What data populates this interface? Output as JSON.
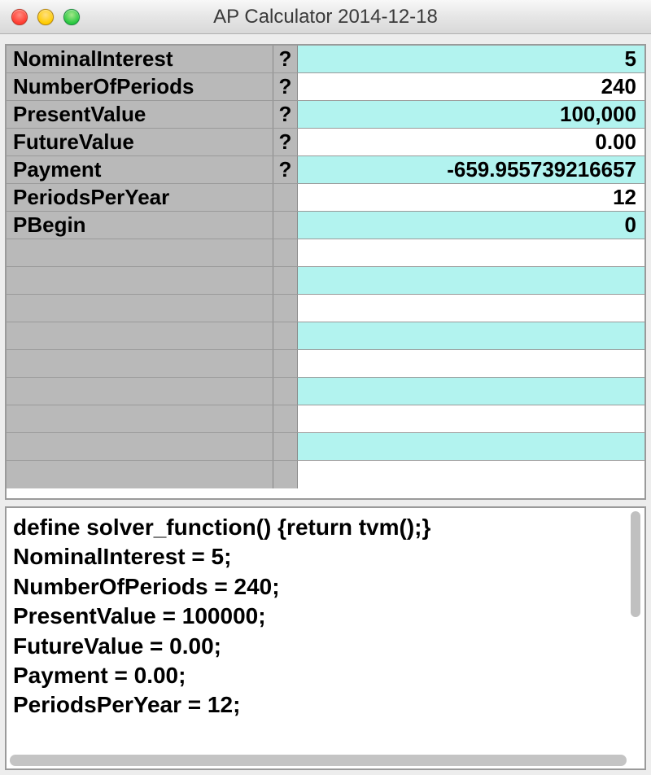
{
  "window": {
    "title": "AP Calculator 2014-12-18"
  },
  "grid": {
    "rows": [
      {
        "label": "NominalInterest",
        "q": "?",
        "value": "5",
        "alt": true
      },
      {
        "label": "NumberOfPeriods",
        "q": "?",
        "value": "240",
        "alt": false
      },
      {
        "label": "PresentValue",
        "q": "?",
        "value": "100,000",
        "alt": true
      },
      {
        "label": "FutureValue",
        "q": "?",
        "value": "0.00",
        "alt": false
      },
      {
        "label": "Payment",
        "q": "?",
        "value": "-659.955739216657",
        "alt": true
      },
      {
        "label": "PeriodsPerYear",
        "q": "",
        "value": "12",
        "alt": false
      },
      {
        "label": "PBegin",
        "q": "",
        "value": "0",
        "alt": true
      },
      {
        "label": "",
        "q": "",
        "value": "",
        "alt": false
      },
      {
        "label": "",
        "q": "",
        "value": "",
        "alt": true
      },
      {
        "label": "",
        "q": "",
        "value": "",
        "alt": false
      },
      {
        "label": "",
        "q": "",
        "value": "",
        "alt": true
      },
      {
        "label": "",
        "q": "",
        "value": "",
        "alt": false
      },
      {
        "label": "",
        "q": "",
        "value": "",
        "alt": true
      },
      {
        "label": "",
        "q": "",
        "value": "",
        "alt": false
      },
      {
        "label": "",
        "q": "",
        "value": "",
        "alt": true
      },
      {
        "label": "",
        "q": "",
        "value": "",
        "alt": false
      }
    ]
  },
  "code": "define solver_function() {return tvm();}\nNominalInterest = 5;\nNumberOfPeriods = 240;\nPresentValue = 100000;\nFutureValue = 0.00;\nPayment = 0.00;\nPeriodsPerYear = 12;"
}
